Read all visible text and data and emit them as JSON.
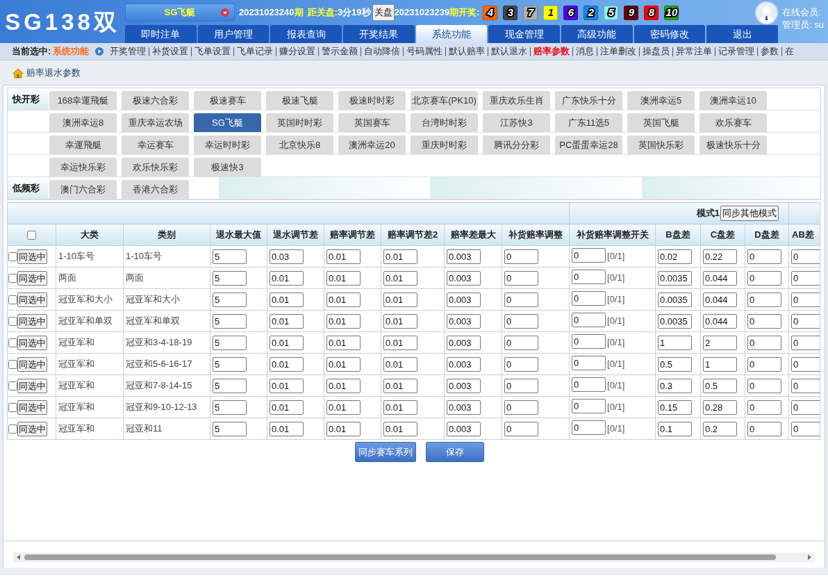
{
  "header": {
    "logo": "SG138双",
    "game_selector": "SG飞艇",
    "current_issue": "20231023240",
    "issue_suffix": "期",
    "countdown_label": "距关盘:",
    "countdown": "3分19秒",
    "close_button": "关盘",
    "last_issue": "20231023239",
    "last_suffix": "期开奖:",
    "balls": [
      {
        "number": "4",
        "color": "#ff6a00"
      },
      {
        "number": "3",
        "color": "#444444"
      },
      {
        "number": "7",
        "color": "#b0b0b0"
      },
      {
        "number": "1",
        "color": "#ffff00"
      },
      {
        "number": "6",
        "color": "#5500ee"
      },
      {
        "number": "2",
        "color": "#0a8cf0"
      },
      {
        "number": "5",
        "color": "#88f5f5"
      },
      {
        "number": "9",
        "color": "#6a0000"
      },
      {
        "number": "8",
        "color": "#ff0000"
      },
      {
        "number": "10",
        "color": "#22aa00"
      }
    ],
    "online_label": "在线会员:",
    "admin_label": "管理员: su"
  },
  "main_tabs": [
    {
      "label": "即时注单",
      "selected": false
    },
    {
      "label": "用户管理",
      "selected": false
    },
    {
      "label": "报表查询",
      "selected": false
    },
    {
      "label": "开奖结果",
      "selected": false
    },
    {
      "label": "系统功能",
      "selected": true
    },
    {
      "label": "现金管理",
      "selected": false
    },
    {
      "label": "高级功能",
      "selected": false
    },
    {
      "label": "密码修改",
      "selected": false
    },
    {
      "label": "退出",
      "selected": false
    }
  ],
  "subnav": {
    "current_label": "当前选中:",
    "current_value": "系统功能",
    "links": [
      {
        "label": "开奖管理",
        "selected": false
      },
      {
        "label": "补货设置",
        "selected": false
      },
      {
        "label": "飞单设置",
        "selected": false
      },
      {
        "label": "飞单记录",
        "selected": false
      },
      {
        "label": "赚分设置",
        "selected": false
      },
      {
        "label": "警示金额",
        "selected": false
      },
      {
        "label": "自动降倍",
        "selected": false
      },
      {
        "label": "号码属性",
        "selected": false
      },
      {
        "label": "默认赔率",
        "selected": false
      },
      {
        "label": "默认退水",
        "selected": false
      },
      {
        "label": "赔率参数",
        "selected": true
      },
      {
        "label": "消息",
        "selected": false
      },
      {
        "label": "注单删改",
        "selected": false
      },
      {
        "label": "操盘员",
        "selected": false
      },
      {
        "label": "异常注单",
        "selected": false
      },
      {
        "label": "记录管理",
        "selected": false
      },
      {
        "label": "参数",
        "selected": false
      },
      {
        "label": "在",
        "selected": false
      }
    ]
  },
  "breadcrumb": {
    "title": "赔率退水参数"
  },
  "game_groups": [
    {
      "label": "快开彩",
      "games": [
        {
          "label": "168幸運飛艇",
          "selected": false
        },
        {
          "label": "极速六合彩",
          "selected": false
        },
        {
          "label": "极速赛车",
          "selected": false
        },
        {
          "label": "极速飞艇",
          "selected": false
        },
        {
          "label": "极速时时彩",
          "selected": false
        },
        {
          "label": "北京赛车(PK10)",
          "selected": false
        },
        {
          "label": "重庆欢乐生肖",
          "selected": false
        },
        {
          "label": "广东快乐十分",
          "selected": false
        },
        {
          "label": "澳洲幸运5",
          "selected": false
        },
        {
          "label": "澳洲幸运10",
          "selected": false
        },
        {
          "label": "澳洲幸运8",
          "selected": false
        },
        {
          "label": "重庆幸运农场",
          "selected": false
        },
        {
          "label": "SG飞艇",
          "selected": true
        },
        {
          "label": "英国时时彩",
          "selected": false
        },
        {
          "label": "英国赛车",
          "selected": false
        },
        {
          "label": "台湾时时彩",
          "selected": false
        },
        {
          "label": "江苏快3",
          "selected": false
        },
        {
          "label": "广东11选5",
          "selected": false
        },
        {
          "label": "英国飞艇",
          "selected": false
        },
        {
          "label": "欢乐赛车",
          "selected": false
        },
        {
          "label": "幸運飛艇",
          "selected": false
        },
        {
          "label": "幸运赛车",
          "selected": false
        },
        {
          "label": "幸运时时彩",
          "selected": false
        },
        {
          "label": "北京快乐8",
          "selected": false
        },
        {
          "label": "澳洲幸运20",
          "selected": false
        },
        {
          "label": "重庆时时彩",
          "selected": false
        },
        {
          "label": "腾讯分分彩",
          "selected": false
        },
        {
          "label": "PC蛋蛋幸运28",
          "selected": false
        },
        {
          "label": "英国快乐彩",
          "selected": false
        },
        {
          "label": "极速快乐十分",
          "selected": false
        },
        {
          "label": "幸运快乐彩",
          "selected": false
        },
        {
          "label": "欢乐快乐彩",
          "selected": false
        },
        {
          "label": "极速快3",
          "selected": false
        }
      ]
    },
    {
      "label": "低频彩",
      "games": [
        {
          "label": "澳门六合彩",
          "selected": false
        },
        {
          "label": "香港六合彩",
          "selected": false
        }
      ]
    }
  ],
  "table": {
    "mode_label": "模式1",
    "sync_modes_button": "同步其他模式",
    "header_checked": false,
    "columns": [
      "大类",
      "类别",
      "退水最大值",
      "退水调节差",
      "赔率调节差",
      "赔率调节差2",
      "赔率差最大",
      "补货赔率调整",
      "补货赔率调整开关",
      "B盘差",
      "C盘差",
      "D盘差",
      "AB差"
    ],
    "rows": [
      {
        "checked": false,
        "sync_button": "同选中",
        "category": "1-10车号",
        "type": "1-10车号",
        "values": [
          "5",
          "0.03",
          "0.01",
          "0.01",
          "0.003",
          "0",
          "0",
          "0.02",
          "0.22",
          "0",
          "0"
        ],
        "switch_hint": "[0/1]"
      },
      {
        "checked": false,
        "sync_button": "同选中",
        "category": "两面",
        "type": "两面",
        "values": [
          "5",
          "0.01",
          "0.01",
          "0.01",
          "0.003",
          "0",
          "0",
          "0.0035",
          "0.044",
          "0",
          "0"
        ],
        "switch_hint": "[0/1]"
      },
      {
        "checked": false,
        "sync_button": "同选中",
        "category": "冠亚军和大小",
        "type": "冠亚军和大小",
        "values": [
          "5",
          "0.01",
          "0.01",
          "0.01",
          "0.003",
          "0",
          "0",
          "0.0035",
          "0.044",
          "0",
          "0"
        ],
        "switch_hint": "[0/1]"
      },
      {
        "checked": false,
        "sync_button": "同选中",
        "category": "冠亚军和单双",
        "type": "冠亚军和单双",
        "values": [
          "5",
          "0.01",
          "0.01",
          "0.01",
          "0.003",
          "0",
          "0",
          "0.0035",
          "0.044",
          "0",
          "0"
        ],
        "switch_hint": "[0/1]"
      },
      {
        "checked": false,
        "sync_button": "同选中",
        "category": "冠亚军和",
        "type": "冠亚和3-4-18-19",
        "values": [
          "5",
          "0.01",
          "0.01",
          "0.01",
          "0.003",
          "0",
          "0",
          "1",
          "2",
          "0",
          "0"
        ],
        "switch_hint": "[0/1]"
      },
      {
        "checked": false,
        "sync_button": "同选中",
        "category": "冠亚军和",
        "type": "冠亚和5-6-16-17",
        "values": [
          "5",
          "0.01",
          "0.01",
          "0.01",
          "0.003",
          "0",
          "0",
          "0.5",
          "1",
          "0",
          "0"
        ],
        "switch_hint": "[0/1]"
      },
      {
        "checked": false,
        "sync_button": "同选中",
        "category": "冠亚军和",
        "type": "冠亚和7-8-14-15",
        "values": [
          "5",
          "0.01",
          "0.01",
          "0.01",
          "0.003",
          "0",
          "0",
          "0.3",
          "0.5",
          "0",
          "0"
        ],
        "switch_hint": "[0/1]"
      },
      {
        "checked": false,
        "sync_button": "同选中",
        "category": "冠亚军和",
        "type": "冠亚和9-10-12-13",
        "values": [
          "5",
          "0.01",
          "0.01",
          "0.01",
          "0.003",
          "0",
          "0",
          "0.15",
          "0.28",
          "0",
          "0"
        ],
        "switch_hint": "[0/1]"
      },
      {
        "checked": false,
        "sync_button": "同选中",
        "category": "冠亚军和",
        "type": "冠亚和11",
        "values": [
          "5",
          "0.01",
          "0.01",
          "0.01",
          "0.003",
          "0",
          "0",
          "0.1",
          "0.2",
          "0",
          "0"
        ],
        "switch_hint": "[0/1]"
      }
    ]
  },
  "actions": [
    "同步赛车系列",
    "保存"
  ]
}
